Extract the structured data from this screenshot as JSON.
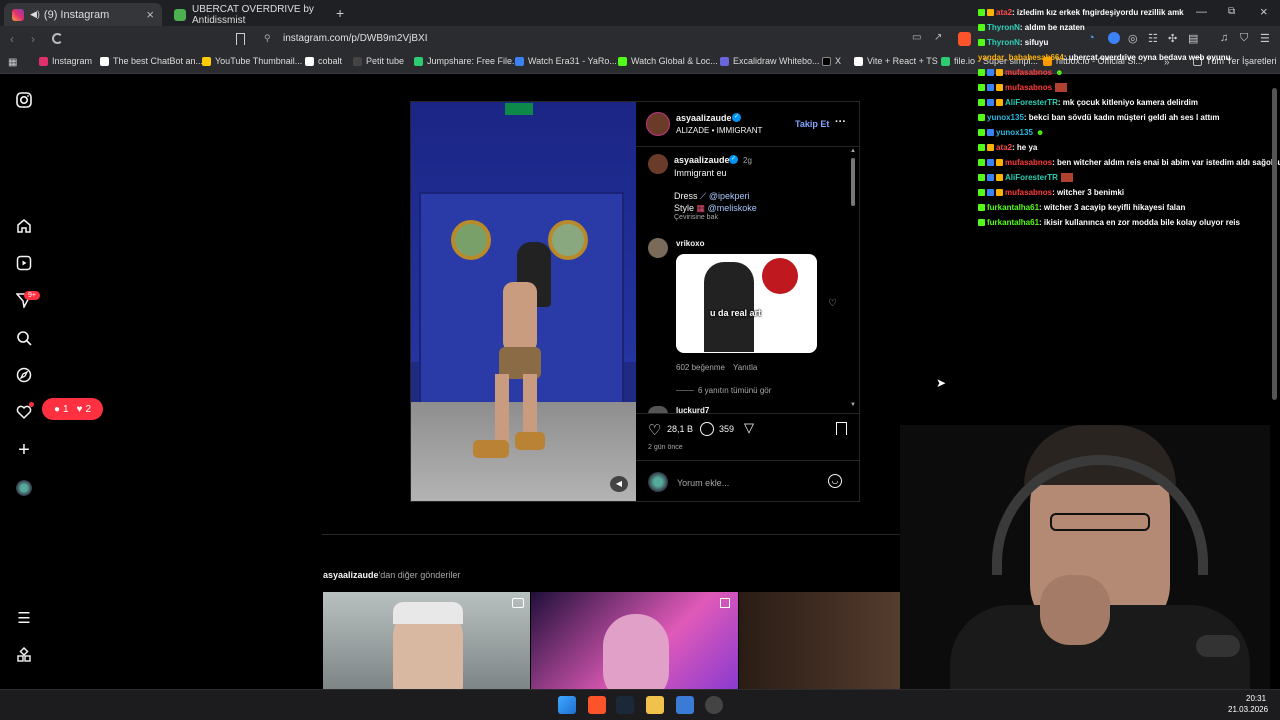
{
  "tabs": [
    {
      "label": "(9) Instagram",
      "active": true
    },
    {
      "label": "UBERCAT OVERDRIVE by Antidissmist",
      "active": false
    }
  ],
  "url": "instagram.com/p/DWB9m2VjBXI",
  "bookmarks": [
    {
      "label": "Instagram",
      "color": "#e1306c"
    },
    {
      "label": "The best ChatBot an...",
      "color": "#ffffff"
    },
    {
      "label": "YouTube Thumbnail...",
      "color": "#ffcc00"
    },
    {
      "label": "cobalt",
      "color": "#ffffff"
    },
    {
      "label": "Petit tube",
      "color": "#222222"
    },
    {
      "label": "Jumpshare: Free File...",
      "color": "#2ecc71"
    },
    {
      "label": "Watch Era31 - YaRo...",
      "color": "#3b82f6"
    },
    {
      "label": "Watch Global & Loc...",
      "color": "#53fc18"
    },
    {
      "label": "Excalidraw Whitebo...",
      "color": "#6965db"
    },
    {
      "label": "X",
      "color": "#000000"
    },
    {
      "label": "Vite + React + TS",
      "color": "#ffffff"
    },
    {
      "label": "file.io - Super simpl...",
      "color": "#2ecc71"
    },
    {
      "label": "hitbox.io - Official Si...",
      "color": "#ff9900"
    }
  ],
  "bookmarks_all": "Tüm Yer İşaretleri",
  "sidebar": {
    "notif_badge": "9+",
    "activity_comments": "1",
    "activity_likes": "2"
  },
  "post": {
    "author": "asyaalizaude",
    "follow": "Takip Et",
    "subtitle": "ALIZADE • IMMIGRANT",
    "caption_author": "asyaalizaude",
    "caption_time": "2g",
    "caption_text": "Immigrant eu",
    "dress_label": "Dress",
    "dress_handle": "@ipekperi",
    "style_label": "Style",
    "style_handle": "@meliskoke",
    "translate": "Çevirisine bak",
    "comment_user": "vrikoxo",
    "meme_text": "u da real art",
    "comment_likes": "602 beğenme",
    "reply": "Yanıtla",
    "view_replies": "6 yanıtın tümünü gör",
    "next_user": "luckurd7",
    "likes": "28,1 B",
    "comments": "359",
    "time_ago": "2 gün önce",
    "add_comment": "Yorum ekle..."
  },
  "more_posts_prefix": "asyaalizaude",
  "more_posts_suffix": "'dan diğer gönderiler",
  "chat": [
    {
      "user": "ata2",
      "color": "#ff4a4a",
      "text": ": izledim kız erkek fngirdeşiyordu rezillik amk"
    },
    {
      "user": "ThyronN",
      "color": "#2cd0b5",
      "text": ": aldım be nzaten"
    },
    {
      "user": "ThyronN",
      "color": "#2cd0b5",
      "text": ": sifuyu"
    },
    {
      "user": "yandar_babahesab664",
      "color": "#ffb300",
      "text": ": ubercat overdrive oyna bedava web oyunu"
    },
    {
      "user": "mufasabnos",
      "color": "#ff3b3b",
      "text": ""
    },
    {
      "user": "mufasabnos",
      "color": "#ff3b3b",
      "text": ""
    },
    {
      "user": "AliForesterTR",
      "color": "#2cd0b5",
      "text": ": mk çocuk kitleniyo kamera delirdim"
    },
    {
      "user": "yunox135",
      "color": "#2cb8e0",
      "text": ": bekci ban sövdü kadın müşteri geldi ah ses l attım"
    },
    {
      "user": "yunox135",
      "color": "#2cb8e0",
      "text": ""
    },
    {
      "user": "ata2",
      "color": "#ff4a4a",
      "text": ": he ya"
    },
    {
      "user": "mufasabnos",
      "color": "#ff3b3b",
      "text": ": ben witcher aldım reis enai bi abim var istedim aldı sağolsun"
    },
    {
      "user": "AliForesterTR",
      "color": "#2cd0b5",
      "text": ""
    },
    {
      "user": "mufasabnos",
      "color": "#ff3b3b",
      "text": ": witcher 3 benimki"
    },
    {
      "user": "furkantalha61",
      "color": "#53fc18",
      "text": ": witcher 3 acayip keyifli hikayesi falan"
    },
    {
      "user": "furkantalha61",
      "color": "#53fc18",
      "text": ": ikisir kullanınca en zor modda bile kolay oluyor reis"
    }
  ],
  "clock": {
    "time": "20:31",
    "date": "21.03.2026"
  }
}
